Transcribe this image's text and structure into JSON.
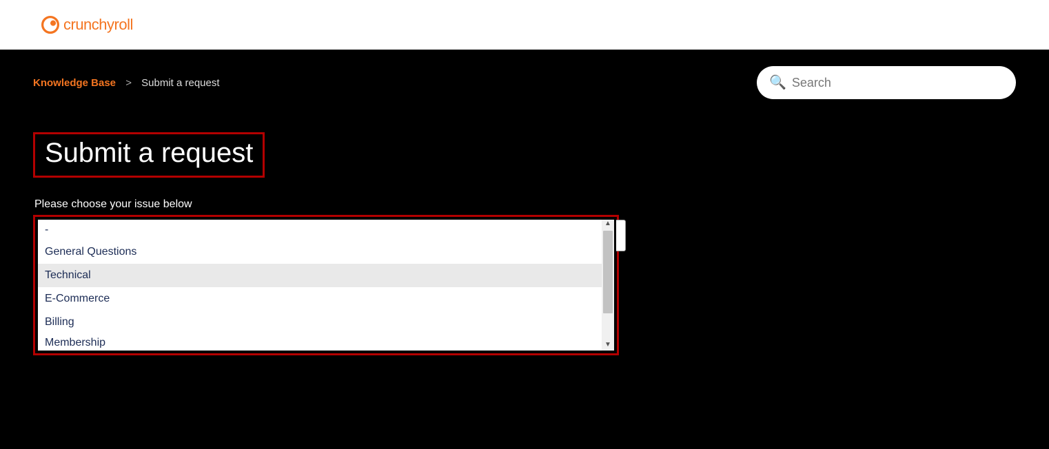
{
  "brand": {
    "name": "crunchyroll"
  },
  "breadcrumb": {
    "root": "Knowledge Base",
    "separator": ">",
    "current": "Submit a request"
  },
  "search": {
    "placeholder": "Search"
  },
  "page_title": "Submit a request",
  "field_label": "Please choose your issue below",
  "options": [
    "-",
    "General Questions",
    "Technical",
    "E-Commerce",
    "Billing",
    "Membership"
  ],
  "selected_option_index": 2,
  "colors": {
    "accent": "#F47521",
    "highlight_border": "#b30000"
  }
}
